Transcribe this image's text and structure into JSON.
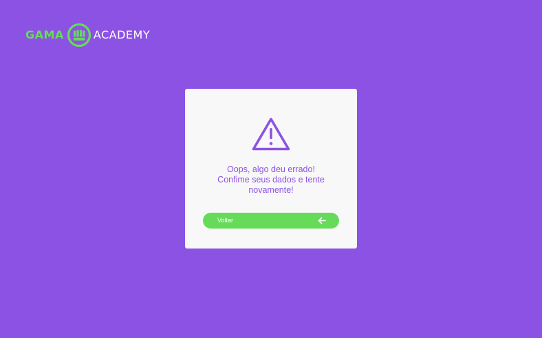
{
  "logo": {
    "left_text": "GAMA",
    "right_text": "ACADEMY"
  },
  "error": {
    "line_1": "Oops, algo deu errado!",
    "line_2": "Confime seus dados e tente",
    "line_3": "novamente!"
  },
  "button": {
    "label": "Voltar",
    "icon": "arrow-left-icon"
  },
  "colors": {
    "background": "#8c52e4",
    "card": "#f8f8f8",
    "accent_green": "#66db5a",
    "text_purple": "#8c52e4"
  }
}
